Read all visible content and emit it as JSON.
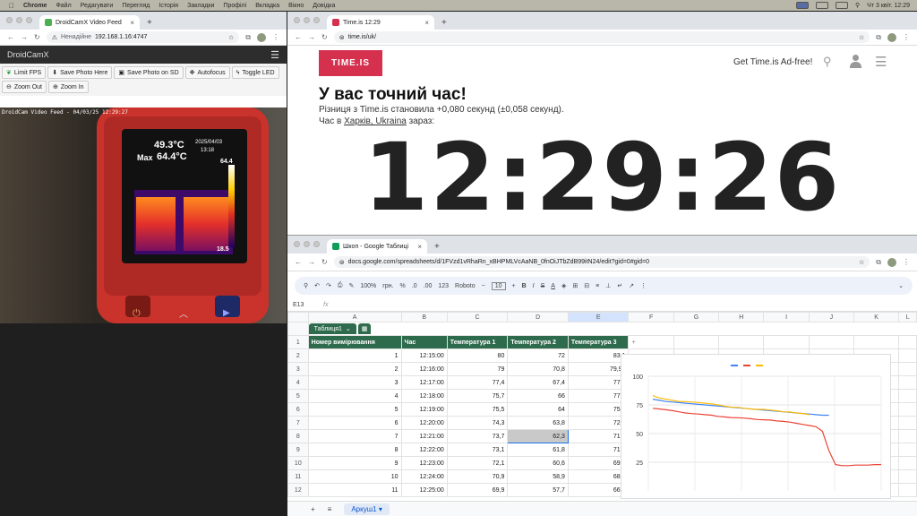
{
  "menubar": {
    "app": "Chrome",
    "items": [
      "Файл",
      "Редагувати",
      "Перегляд",
      "Історія",
      "Закладки",
      "Профілі",
      "Вкладка",
      "Вікно",
      "Довідка"
    ],
    "clock": "Чт 3 квіт.  12:29"
  },
  "droidcam": {
    "tab_title": "DroidCamX Video Feed",
    "security": "Ненадійне",
    "url": "192.168.1.16:4747",
    "brand": "DroidCamX",
    "buttons": [
      "Limit FPS",
      "Save Photo Here",
      "Save Photo on SD",
      "Autofocus",
      "Toggle LED",
      "Zoom Out",
      "Zoom In"
    ],
    "overlay": "DroidCam Video Feed - 04/03/25 12:29:27",
    "thermo": {
      "max_label": "Max",
      "center_temp": "49.3°C",
      "max_temp": "64.4°C",
      "date": "2025/04/03",
      "time": "13:18",
      "scale_high": "64.4",
      "scale_low": "18.5"
    }
  },
  "timeis": {
    "tab_title": "Time.is 12:29",
    "url": "time.is/uk/",
    "logo": "TIME.IS",
    "adfree": "Get Time.is Ad-free!",
    "headline": "У вас точний час!",
    "diff": "Різниця з Time.is становила +0,080 секунд (±0,058 секунд).",
    "city_prefix": "Час в ",
    "city_link": "Харків, Ukraina",
    "city_suffix": " зараз:",
    "clock": "12:29:26"
  },
  "sheets": {
    "tab_title": "Шкоп - Google Таблиці",
    "url": "docs.google.com/spreadsheets/d/1FVzd1vRhaRn_xBHPMLVcAaNB_0fnOiJTbZdB99itN24/edit?gid=0#gid=0",
    "zoom": "100%",
    "currency": "грн.",
    "pct": "%",
    "dec_less": ".0",
    "dec_more": ".00",
    "fmt": "123",
    "font": "Roboto",
    "size": "10",
    "cellref": "E13",
    "fx": "fx",
    "table_name": "Таблиця1",
    "sheet_tab": "Аркуш1",
    "columns": [
      "A",
      "B",
      "C",
      "D",
      "E",
      "F",
      "G",
      "H",
      "I",
      "J",
      "K",
      "L"
    ],
    "headers": [
      "Номер вимірювання",
      "Час",
      "Температура 1",
      "Температура 2",
      "Температура 3"
    ],
    "rows": [
      [
        "1",
        "12:15:00",
        "80",
        "72",
        "83,1"
      ],
      [
        "2",
        "12:16:00",
        "79",
        "70,8",
        "79,99"
      ],
      [
        "3",
        "12:17:00",
        "77,4",
        "67,4",
        "77,9"
      ],
      [
        "4",
        "12:18:00",
        "75,7",
        "66",
        "77,1"
      ],
      [
        "5",
        "12:19:00",
        "75,5",
        "64",
        "75,9"
      ],
      [
        "6",
        "12:20:00",
        "74,3",
        "63,8",
        "72,9"
      ],
      [
        "7",
        "12:21:00",
        "73,7",
        "62,3",
        "71,1"
      ],
      [
        "8",
        "12:22:00",
        "73,1",
        "61,8",
        "71,1"
      ],
      [
        "9",
        "12:23:00",
        "72,1",
        "60,6",
        "69,9"
      ],
      [
        "10",
        "12:24:00",
        "70,9",
        "58,9",
        "68,8"
      ],
      [
        "11",
        "12:25:00",
        "69,9",
        "57,7",
        "66,5"
      ]
    ],
    "row_numbers": [
      "1",
      "2",
      "3",
      "4",
      "5",
      "6",
      "7",
      "8",
      "9",
      "10",
      "11",
      "12"
    ]
  },
  "chart_data": {
    "type": "line",
    "ylim": [
      0,
      100
    ],
    "yticks": [
      "100",
      "75",
      "50",
      "25"
    ],
    "series": [
      {
        "color": "#4285f4",
        "values": [
          80,
          79,
          78,
          77.5,
          77,
          76.5,
          76,
          75.5,
          75,
          74.5,
          74,
          73.5,
          73,
          72.5,
          72,
          71.5,
          71,
          70.5,
          70,
          69.5,
          69,
          68.5,
          68,
          67.5,
          67,
          66.5,
          66,
          66
        ]
      },
      {
        "color": "#ea4335",
        "values": [
          72,
          71.5,
          70.8,
          70,
          69,
          68,
          67.4,
          67,
          66.5,
          66,
          65,
          64.5,
          64,
          63.8,
          63.5,
          63,
          62.3,
          62,
          61.8,
          61,
          60.6,
          60,
          59,
          58,
          57,
          56,
          52,
          35,
          23,
          22,
          22,
          22.5,
          22.5,
          22.5,
          23,
          23
        ]
      },
      {
        "color": "#fbbc04",
        "values": [
          83.1,
          81,
          80,
          79,
          78,
          77.9,
          77.5,
          77.1,
          76.5,
          75.9,
          75,
          74,
          73,
          72.9,
          72,
          71.5,
          71.1,
          71.1,
          70.5,
          69.9,
          69,
          68.8,
          68,
          67.5,
          66.5
        ]
      }
    ]
  }
}
